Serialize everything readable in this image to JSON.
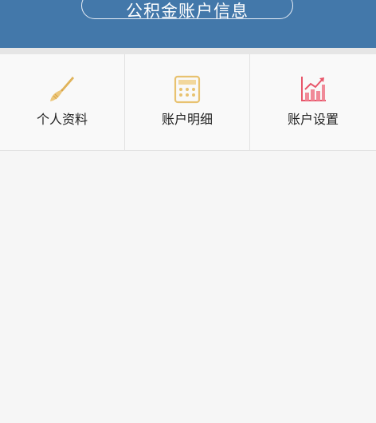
{
  "header": {
    "title": "公积金账户信息"
  },
  "menu": {
    "items": [
      {
        "label": "个人资料",
        "icon": "brush-icon"
      },
      {
        "label": "账户明细",
        "icon": "calculator-icon"
      },
      {
        "label": "账户设置",
        "icon": "bar-chart-icon"
      }
    ]
  },
  "colors": {
    "header_bg": "#4378aa",
    "brush_icon": "#e8c270",
    "calculator_icon": "#e8c270",
    "chart_icon": "#e8566a"
  }
}
